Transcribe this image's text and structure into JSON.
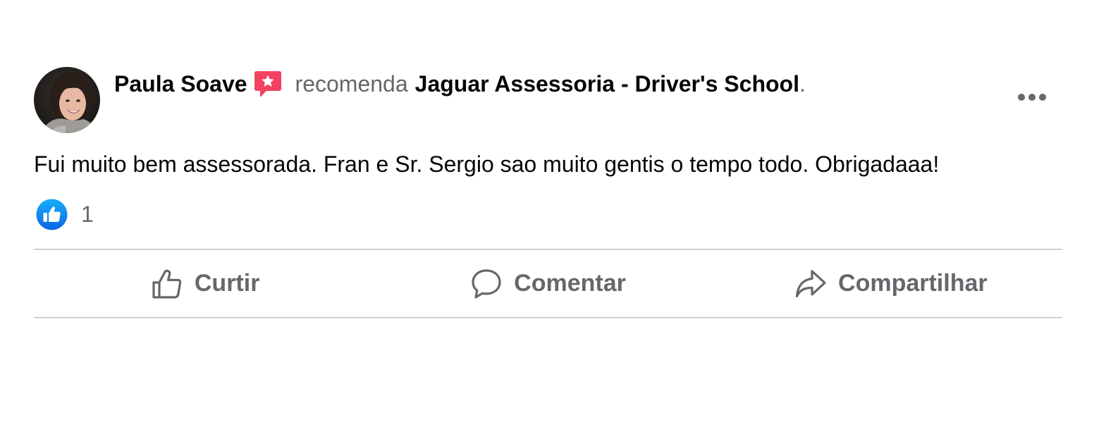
{
  "post": {
    "author": {
      "name": "Paula Soave",
      "avatar_icon": "profile-photo"
    },
    "recommend_icon": "recommendation-star-icon",
    "verb": "recomenda",
    "page_name": "Jaguar Assessoria - Driver's School",
    "punctuation": ".",
    "more_icon": "more-options-icon",
    "text": "Fui muito bem assessorada. Fran e Sr. Sergio sao muito gentis o tempo todo. Obrigadaaa!",
    "reactions": {
      "icon": "like-reaction-icon",
      "count": "1"
    },
    "actions": [
      {
        "label": "Curtir",
        "icon": "thumbs-up-icon"
      },
      {
        "label": "Comentar",
        "icon": "comment-icon"
      },
      {
        "label": "Compartilhar",
        "icon": "share-icon"
      }
    ]
  },
  "colors": {
    "text_primary": "#050505",
    "text_secondary": "#65676b",
    "recommend_red": "#f3425f",
    "like_blue": "#1877f2",
    "divider": "#ced0d4"
  }
}
